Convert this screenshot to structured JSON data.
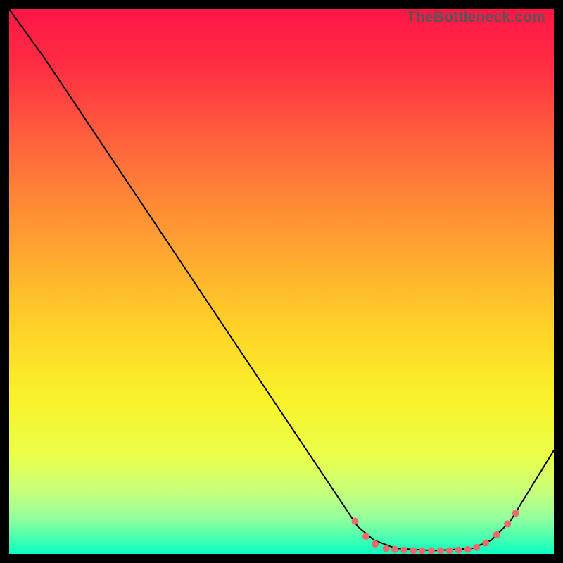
{
  "watermark": {
    "text": "TheBottleneck.com"
  },
  "chart_data": {
    "type": "line",
    "title": "",
    "xlabel": "",
    "ylabel": "",
    "xlim": [
      0,
      100
    ],
    "ylim": [
      0,
      100
    ],
    "grid": false,
    "legend_position": "none",
    "background_gradient": {
      "type": "linear-vertical",
      "stops": [
        {
          "offset": 0.0,
          "color": "#ff1647"
        },
        {
          "offset": 0.1,
          "color": "#ff2c42"
        },
        {
          "offset": 0.22,
          "color": "#ff5a3e"
        },
        {
          "offset": 0.35,
          "color": "#ff8736"
        },
        {
          "offset": 0.48,
          "color": "#ffb12e"
        },
        {
          "offset": 0.6,
          "color": "#ffd627"
        },
        {
          "offset": 0.72,
          "color": "#f8f32b"
        },
        {
          "offset": 0.82,
          "color": "#eaff4a"
        },
        {
          "offset": 0.88,
          "color": "#cbff77"
        },
        {
          "offset": 0.93,
          "color": "#9aff9a"
        },
        {
          "offset": 0.97,
          "color": "#4affb0"
        },
        {
          "offset": 1.0,
          "color": "#0affc4"
        }
      ]
    },
    "curve": {
      "color": "#000000",
      "points": [
        {
          "x": 0.0,
          "y": 100.0
        },
        {
          "x": 6.5,
          "y": 91.0
        },
        {
          "x": 64.0,
          "y": 5.0
        },
        {
          "x": 67.0,
          "y": 2.5
        },
        {
          "x": 71.0,
          "y": 1.0
        },
        {
          "x": 78.0,
          "y": 0.6
        },
        {
          "x": 85.0,
          "y": 1.0
        },
        {
          "x": 88.5,
          "y": 2.5
        },
        {
          "x": 92.0,
          "y": 6.0
        },
        {
          "x": 100.0,
          "y": 19.0
        }
      ]
    },
    "markers": {
      "color": "#ed6a6a",
      "radius_px": 5,
      "points": [
        {
          "x": 63.5,
          "y": 6.0
        },
        {
          "x": 65.5,
          "y": 3.2
        },
        {
          "x": 67.2,
          "y": 1.8
        },
        {
          "x": 69.2,
          "y": 1.0
        },
        {
          "x": 70.8,
          "y": 0.8
        },
        {
          "x": 72.5,
          "y": 0.7
        },
        {
          "x": 74.2,
          "y": 0.6
        },
        {
          "x": 75.8,
          "y": 0.6
        },
        {
          "x": 77.5,
          "y": 0.6
        },
        {
          "x": 79.2,
          "y": 0.6
        },
        {
          "x": 80.8,
          "y": 0.6
        },
        {
          "x": 82.5,
          "y": 0.7
        },
        {
          "x": 84.2,
          "y": 0.8
        },
        {
          "x": 85.8,
          "y": 1.2
        },
        {
          "x": 87.5,
          "y": 2.0
        },
        {
          "x": 89.5,
          "y": 3.5
        },
        {
          "x": 91.5,
          "y": 5.5
        },
        {
          "x": 93.0,
          "y": 7.5
        }
      ]
    }
  }
}
